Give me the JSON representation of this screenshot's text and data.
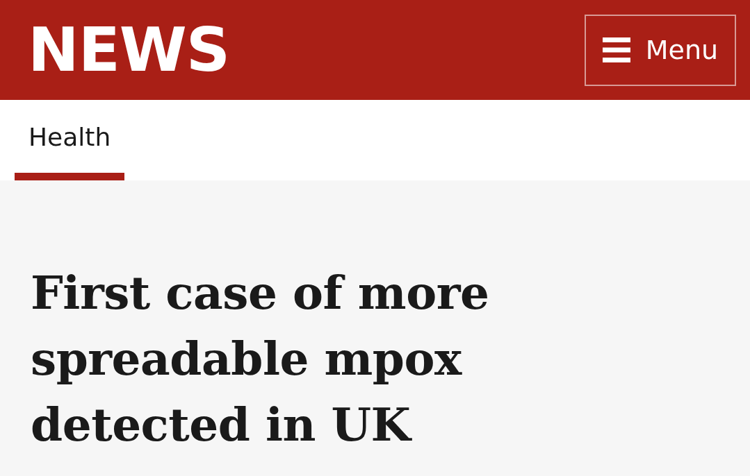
{
  "header": {
    "logo": "NEWS",
    "menu_button": {
      "label": "Menu"
    }
  },
  "nav": {
    "tabs": [
      {
        "label": "Health",
        "selected": true
      }
    ]
  },
  "article": {
    "headline": "First case of more spreadable mpox detected in UK"
  }
}
